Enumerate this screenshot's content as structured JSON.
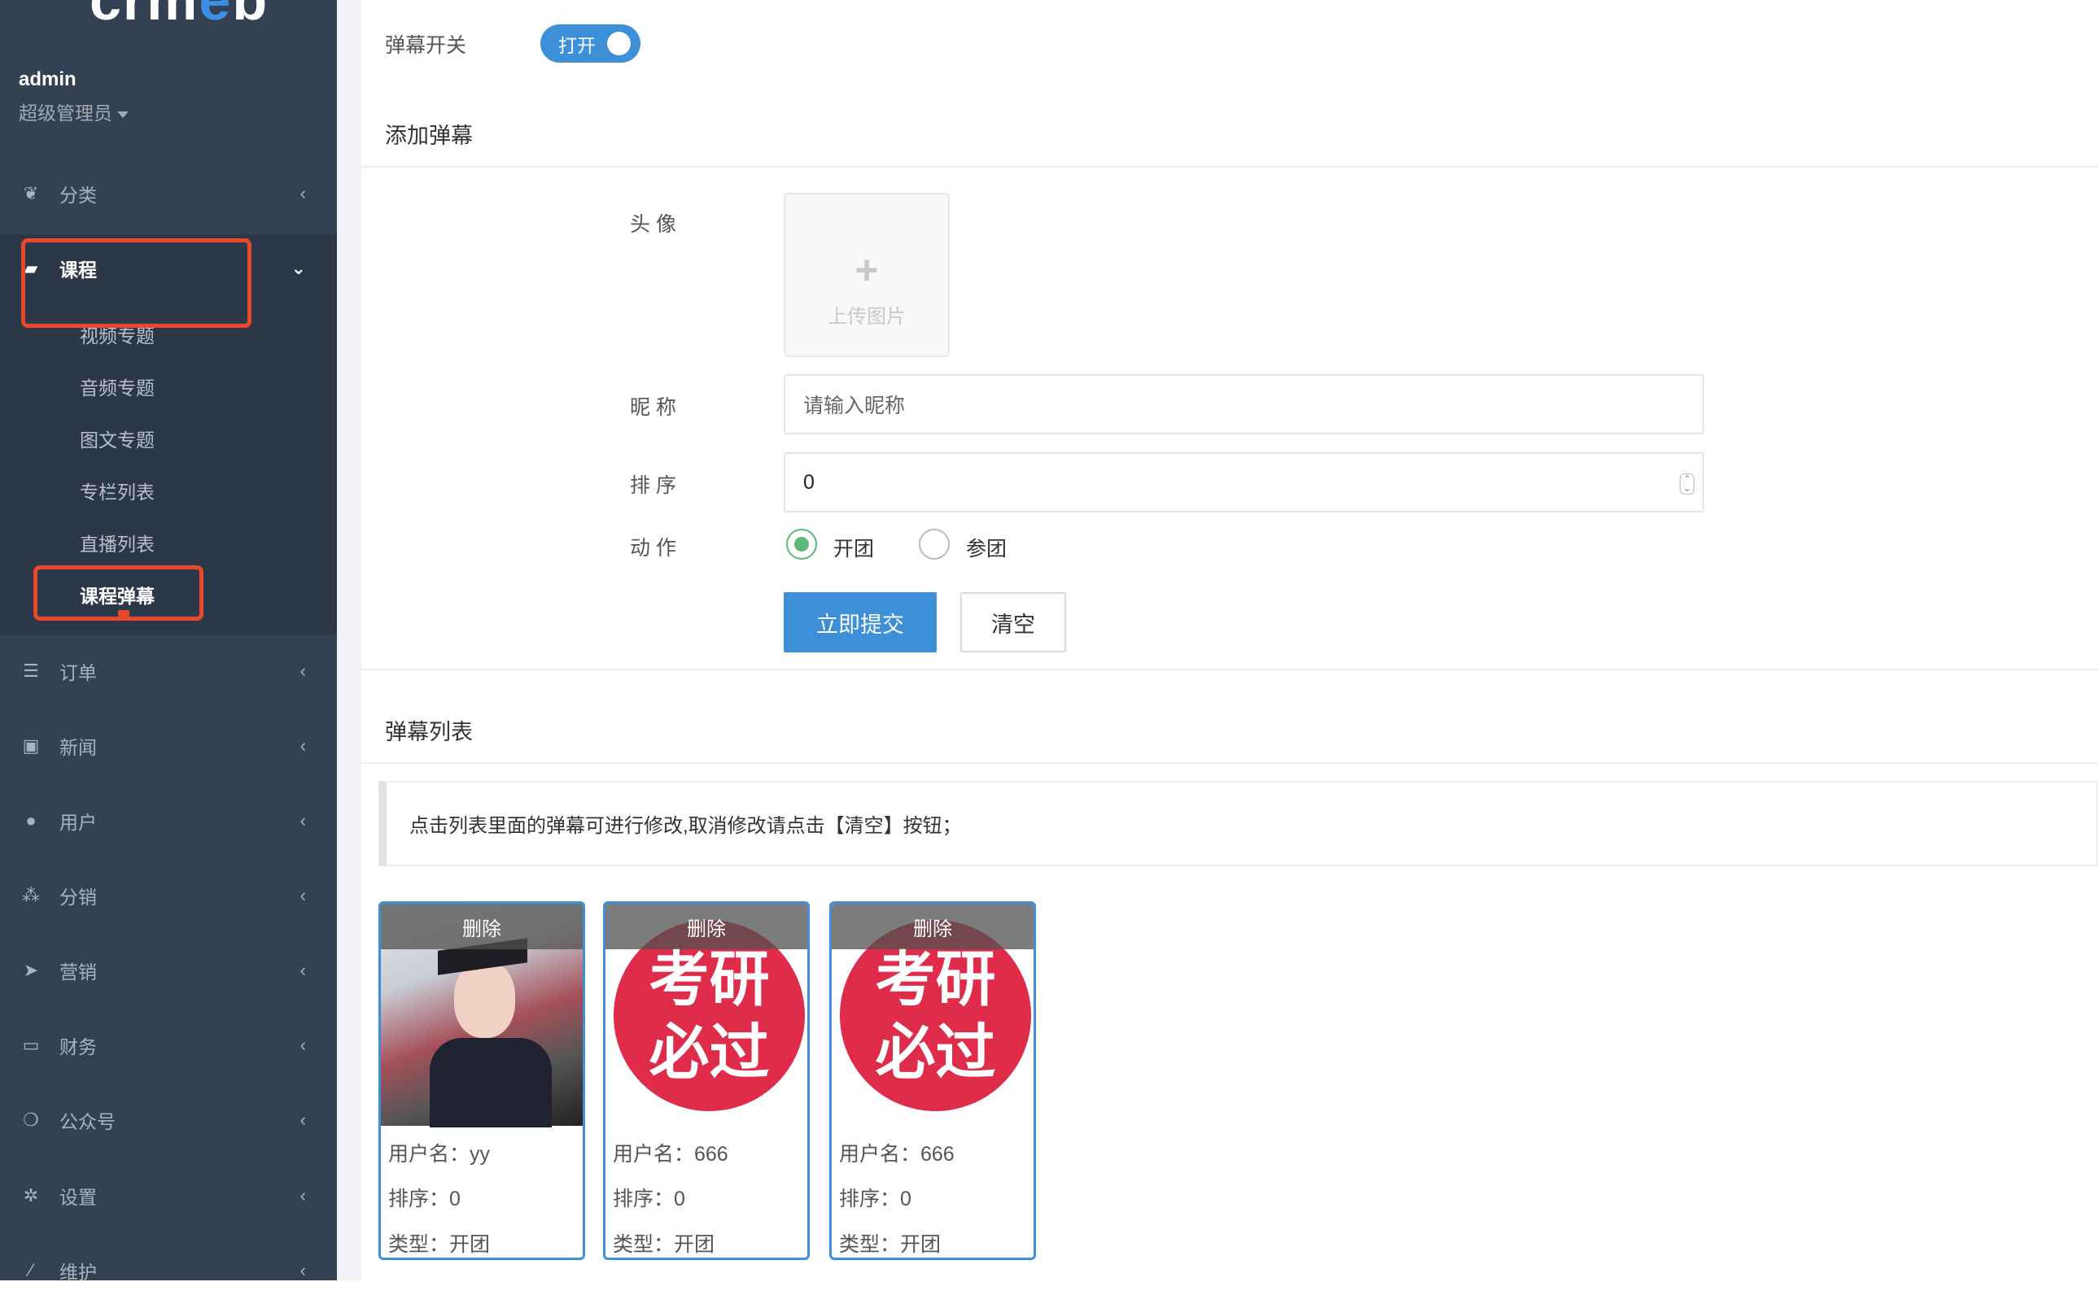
{
  "sidebar": {
    "logo": {
      "pre": "crm",
      "accent": "e",
      "post": "b"
    },
    "user": {
      "name": "admin",
      "role": "超级管理员"
    },
    "menu": [
      {
        "label": "分类",
        "icon": "leaf-icon"
      },
      {
        "label": "课程",
        "icon": "book-icon"
      },
      {
        "label": "订单",
        "icon": "list-icon"
      },
      {
        "label": "新闻",
        "icon": "image-icon"
      },
      {
        "label": "用户",
        "icon": "user-icon"
      },
      {
        "label": "分销",
        "icon": "users-icon"
      },
      {
        "label": "营销",
        "icon": "paper-plane-icon"
      },
      {
        "label": "财务",
        "icon": "money-icon"
      },
      {
        "label": "公众号",
        "icon": "wechat-icon"
      },
      {
        "label": "设置",
        "icon": "gear-icon"
      },
      {
        "label": "维护",
        "icon": "magic-wand-icon"
      }
    ],
    "course_sub": [
      "视频专题",
      "音频专题",
      "图文专题",
      "专栏列表",
      "直播列表",
      "课程弹幕"
    ]
  },
  "switch": {
    "label": "弹幕开关",
    "state": "打开"
  },
  "add": {
    "title": "添加弹幕",
    "avatar_label": "头 像",
    "upload_text": "上传图片",
    "nickname_label": "昵 称",
    "nickname_placeholder": "请输入昵称",
    "sort_label": "排 序",
    "sort_value": "0",
    "action_label": "动 作",
    "actions": [
      "开团",
      "参团"
    ],
    "selected_action": "开团",
    "submit": "立即提交",
    "clear": "清空"
  },
  "list": {
    "title": "弹幕列表",
    "tip": "点击列表里面的弹幕可进行修改,取消修改请点击【清空】按钮；",
    "delete": "删除",
    "image_text": [
      "考研",
      "必过"
    ],
    "cards": [
      {
        "username": "用户名：yy",
        "sort": "排序：0",
        "type": "类型：开团"
      },
      {
        "username": "用户名：666",
        "sort": "排序：0",
        "type": "类型：开团"
      },
      {
        "username": "用户名：666",
        "sort": "排序：0",
        "type": "类型：开团"
      }
    ]
  },
  "colors": {
    "sidebar": "#344152",
    "accent": "#3d8fd8",
    "highlight": "#e8492a"
  }
}
